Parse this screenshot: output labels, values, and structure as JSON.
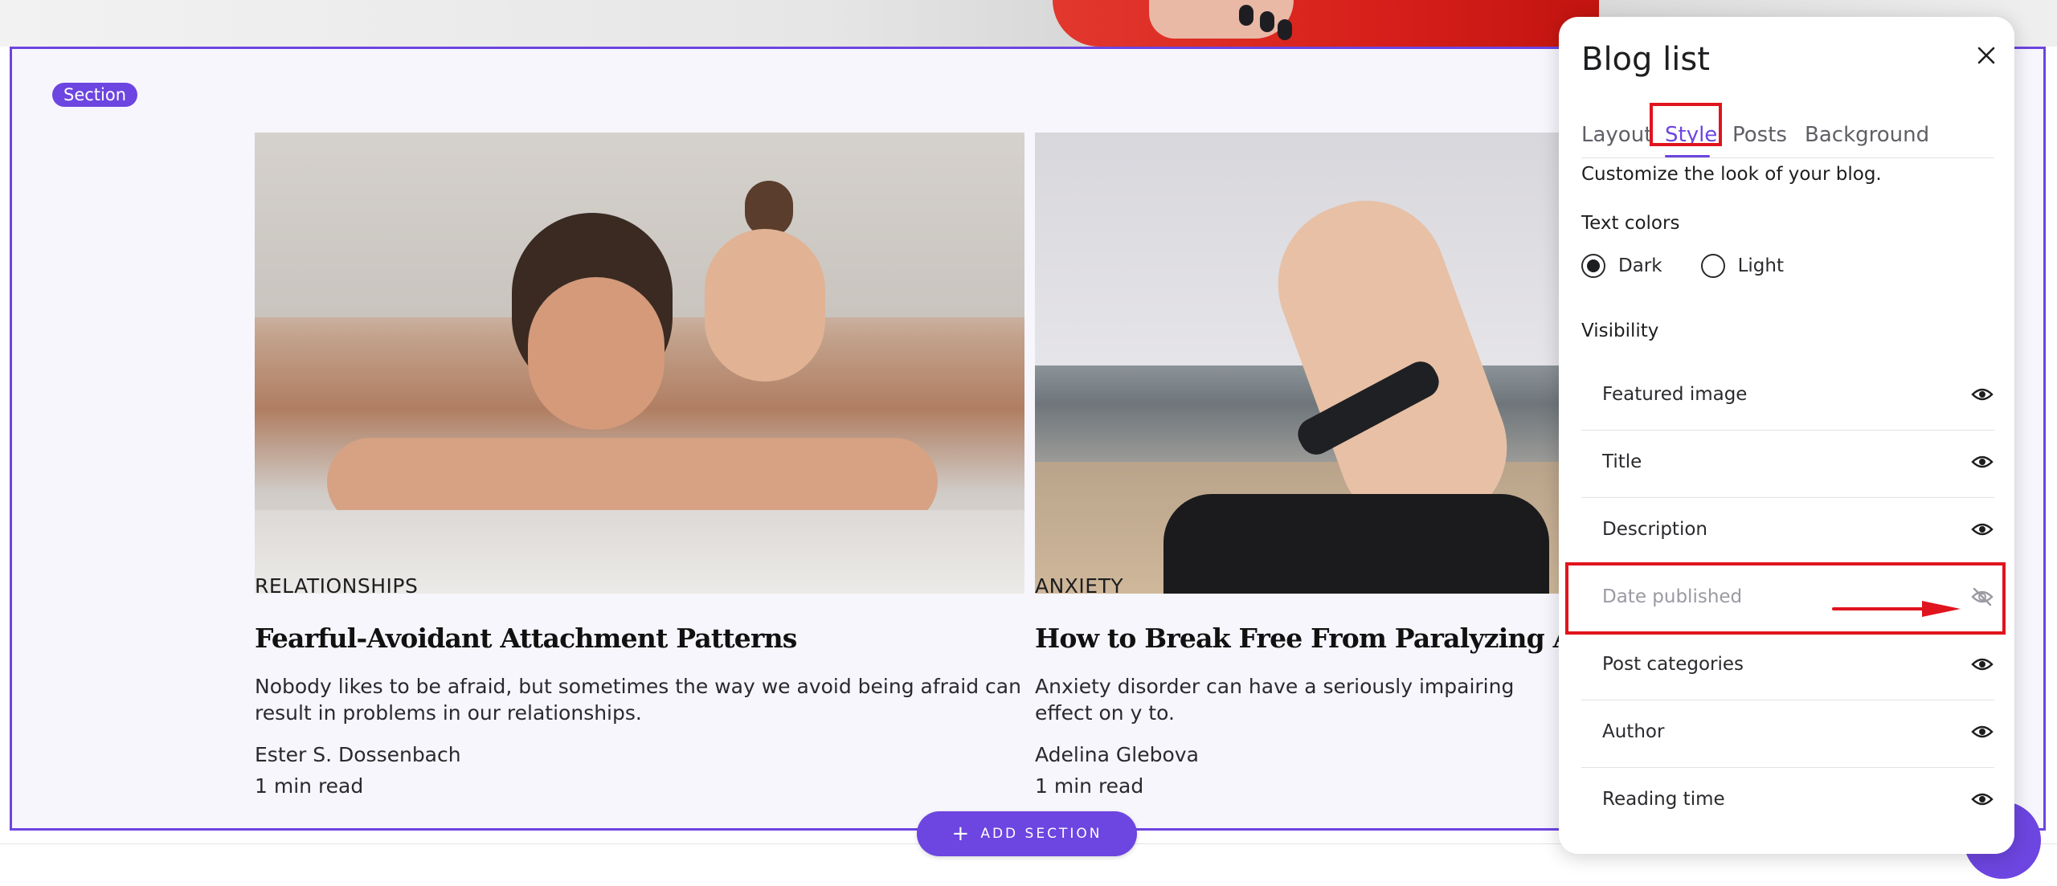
{
  "section": {
    "badge": "Section"
  },
  "posts": [
    {
      "category": "RELATIONSHIPS",
      "title": "Fearful-Avoidant Attachment Patterns",
      "description": "Nobody likes to be afraid, but sometimes the way we avoid being afraid can result in problems in our relationships.",
      "author": "Ester S. Dossenbach",
      "read_time": "1 min read"
    },
    {
      "category": "ANXIETY",
      "title": "How to Break Free From Paralyzing Anxiety",
      "description": "Anxiety disorder can have a seriously impairing effect on y to.",
      "author": "Adelina Glebova",
      "read_time": "1 min read"
    }
  ],
  "add_section_label": "ADD SECTION",
  "panel": {
    "title": "Blog list",
    "tabs": [
      "Layout",
      "Style",
      "Posts",
      "Background"
    ],
    "active_tab": "Style",
    "intro": "Customize the look of your blog.",
    "text_colors": {
      "label": "Text colors",
      "options": [
        "Dark",
        "Light"
      ],
      "selected": "Dark"
    },
    "visibility": {
      "label": "Visibility",
      "items": [
        {
          "label": "Featured image",
          "visible": true,
          "icon": "eye-icon"
        },
        {
          "label": "Title",
          "visible": true,
          "icon": "eye-icon"
        },
        {
          "label": "Description",
          "visible": true,
          "icon": "eye-icon"
        },
        {
          "label": "Date published",
          "visible": false,
          "icon": "eye-off-icon"
        },
        {
          "label": "Post categories",
          "visible": true,
          "icon": "eye-icon"
        },
        {
          "label": "Author",
          "visible": true,
          "icon": "eye-icon"
        },
        {
          "label": "Reading time",
          "visible": true,
          "icon": "eye-icon"
        }
      ]
    }
  },
  "colors": {
    "accent": "#6d45e0",
    "highlight": "#e0141d",
    "text": "#1d1e20",
    "muted": "#9a9aa2"
  }
}
